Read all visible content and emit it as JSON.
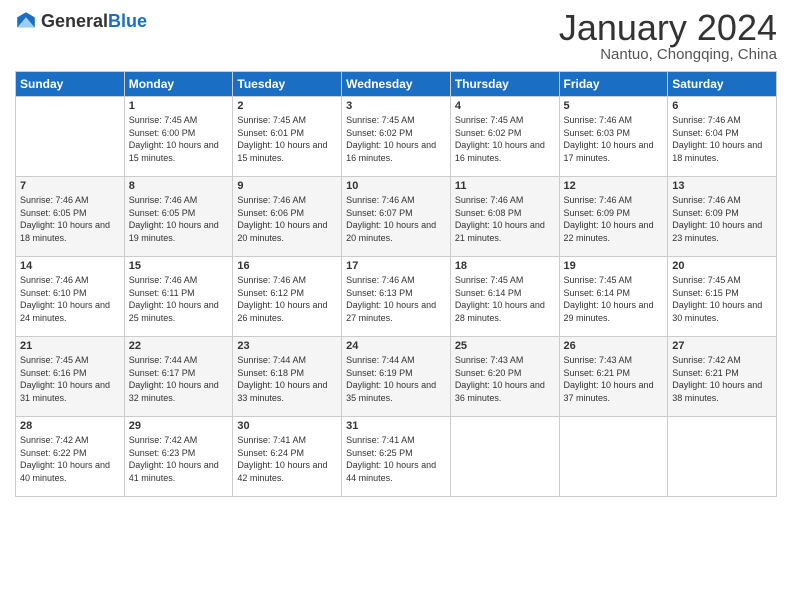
{
  "header": {
    "logo_general": "General",
    "logo_blue": "Blue",
    "title": "January 2024",
    "subtitle": "Nantuo, Chongqing, China"
  },
  "days_of_week": [
    "Sunday",
    "Monday",
    "Tuesday",
    "Wednesday",
    "Thursday",
    "Friday",
    "Saturday"
  ],
  "weeks": [
    [
      {
        "day": "",
        "sunrise": "",
        "sunset": "",
        "daylight": ""
      },
      {
        "day": "1",
        "sunrise": "Sunrise: 7:45 AM",
        "sunset": "Sunset: 6:00 PM",
        "daylight": "Daylight: 10 hours and 15 minutes."
      },
      {
        "day": "2",
        "sunrise": "Sunrise: 7:45 AM",
        "sunset": "Sunset: 6:01 PM",
        "daylight": "Daylight: 10 hours and 15 minutes."
      },
      {
        "day": "3",
        "sunrise": "Sunrise: 7:45 AM",
        "sunset": "Sunset: 6:02 PM",
        "daylight": "Daylight: 10 hours and 16 minutes."
      },
      {
        "day": "4",
        "sunrise": "Sunrise: 7:45 AM",
        "sunset": "Sunset: 6:02 PM",
        "daylight": "Daylight: 10 hours and 16 minutes."
      },
      {
        "day": "5",
        "sunrise": "Sunrise: 7:46 AM",
        "sunset": "Sunset: 6:03 PM",
        "daylight": "Daylight: 10 hours and 17 minutes."
      },
      {
        "day": "6",
        "sunrise": "Sunrise: 7:46 AM",
        "sunset": "Sunset: 6:04 PM",
        "daylight": "Daylight: 10 hours and 18 minutes."
      }
    ],
    [
      {
        "day": "7",
        "sunrise": "Sunrise: 7:46 AM",
        "sunset": "Sunset: 6:05 PM",
        "daylight": "Daylight: 10 hours and 18 minutes."
      },
      {
        "day": "8",
        "sunrise": "Sunrise: 7:46 AM",
        "sunset": "Sunset: 6:05 PM",
        "daylight": "Daylight: 10 hours and 19 minutes."
      },
      {
        "day": "9",
        "sunrise": "Sunrise: 7:46 AM",
        "sunset": "Sunset: 6:06 PM",
        "daylight": "Daylight: 10 hours and 20 minutes."
      },
      {
        "day": "10",
        "sunrise": "Sunrise: 7:46 AM",
        "sunset": "Sunset: 6:07 PM",
        "daylight": "Daylight: 10 hours and 20 minutes."
      },
      {
        "day": "11",
        "sunrise": "Sunrise: 7:46 AM",
        "sunset": "Sunset: 6:08 PM",
        "daylight": "Daylight: 10 hours and 21 minutes."
      },
      {
        "day": "12",
        "sunrise": "Sunrise: 7:46 AM",
        "sunset": "Sunset: 6:09 PM",
        "daylight": "Daylight: 10 hours and 22 minutes."
      },
      {
        "day": "13",
        "sunrise": "Sunrise: 7:46 AM",
        "sunset": "Sunset: 6:09 PM",
        "daylight": "Daylight: 10 hours and 23 minutes."
      }
    ],
    [
      {
        "day": "14",
        "sunrise": "Sunrise: 7:46 AM",
        "sunset": "Sunset: 6:10 PM",
        "daylight": "Daylight: 10 hours and 24 minutes."
      },
      {
        "day": "15",
        "sunrise": "Sunrise: 7:46 AM",
        "sunset": "Sunset: 6:11 PM",
        "daylight": "Daylight: 10 hours and 25 minutes."
      },
      {
        "day": "16",
        "sunrise": "Sunrise: 7:46 AM",
        "sunset": "Sunset: 6:12 PM",
        "daylight": "Daylight: 10 hours and 26 minutes."
      },
      {
        "day": "17",
        "sunrise": "Sunrise: 7:46 AM",
        "sunset": "Sunset: 6:13 PM",
        "daylight": "Daylight: 10 hours and 27 minutes."
      },
      {
        "day": "18",
        "sunrise": "Sunrise: 7:45 AM",
        "sunset": "Sunset: 6:14 PM",
        "daylight": "Daylight: 10 hours and 28 minutes."
      },
      {
        "day": "19",
        "sunrise": "Sunrise: 7:45 AM",
        "sunset": "Sunset: 6:14 PM",
        "daylight": "Daylight: 10 hours and 29 minutes."
      },
      {
        "day": "20",
        "sunrise": "Sunrise: 7:45 AM",
        "sunset": "Sunset: 6:15 PM",
        "daylight": "Daylight: 10 hours and 30 minutes."
      }
    ],
    [
      {
        "day": "21",
        "sunrise": "Sunrise: 7:45 AM",
        "sunset": "Sunset: 6:16 PM",
        "daylight": "Daylight: 10 hours and 31 minutes."
      },
      {
        "day": "22",
        "sunrise": "Sunrise: 7:44 AM",
        "sunset": "Sunset: 6:17 PM",
        "daylight": "Daylight: 10 hours and 32 minutes."
      },
      {
        "day": "23",
        "sunrise": "Sunrise: 7:44 AM",
        "sunset": "Sunset: 6:18 PM",
        "daylight": "Daylight: 10 hours and 33 minutes."
      },
      {
        "day": "24",
        "sunrise": "Sunrise: 7:44 AM",
        "sunset": "Sunset: 6:19 PM",
        "daylight": "Daylight: 10 hours and 35 minutes."
      },
      {
        "day": "25",
        "sunrise": "Sunrise: 7:43 AM",
        "sunset": "Sunset: 6:20 PM",
        "daylight": "Daylight: 10 hours and 36 minutes."
      },
      {
        "day": "26",
        "sunrise": "Sunrise: 7:43 AM",
        "sunset": "Sunset: 6:21 PM",
        "daylight": "Daylight: 10 hours and 37 minutes."
      },
      {
        "day": "27",
        "sunrise": "Sunrise: 7:42 AM",
        "sunset": "Sunset: 6:21 PM",
        "daylight": "Daylight: 10 hours and 38 minutes."
      }
    ],
    [
      {
        "day": "28",
        "sunrise": "Sunrise: 7:42 AM",
        "sunset": "Sunset: 6:22 PM",
        "daylight": "Daylight: 10 hours and 40 minutes."
      },
      {
        "day": "29",
        "sunrise": "Sunrise: 7:42 AM",
        "sunset": "Sunset: 6:23 PM",
        "daylight": "Daylight: 10 hours and 41 minutes."
      },
      {
        "day": "30",
        "sunrise": "Sunrise: 7:41 AM",
        "sunset": "Sunset: 6:24 PM",
        "daylight": "Daylight: 10 hours and 42 minutes."
      },
      {
        "day": "31",
        "sunrise": "Sunrise: 7:41 AM",
        "sunset": "Sunset: 6:25 PM",
        "daylight": "Daylight: 10 hours and 44 minutes."
      },
      {
        "day": "",
        "sunrise": "",
        "sunset": "",
        "daylight": ""
      },
      {
        "day": "",
        "sunrise": "",
        "sunset": "",
        "daylight": ""
      },
      {
        "day": "",
        "sunrise": "",
        "sunset": "",
        "daylight": ""
      }
    ]
  ]
}
